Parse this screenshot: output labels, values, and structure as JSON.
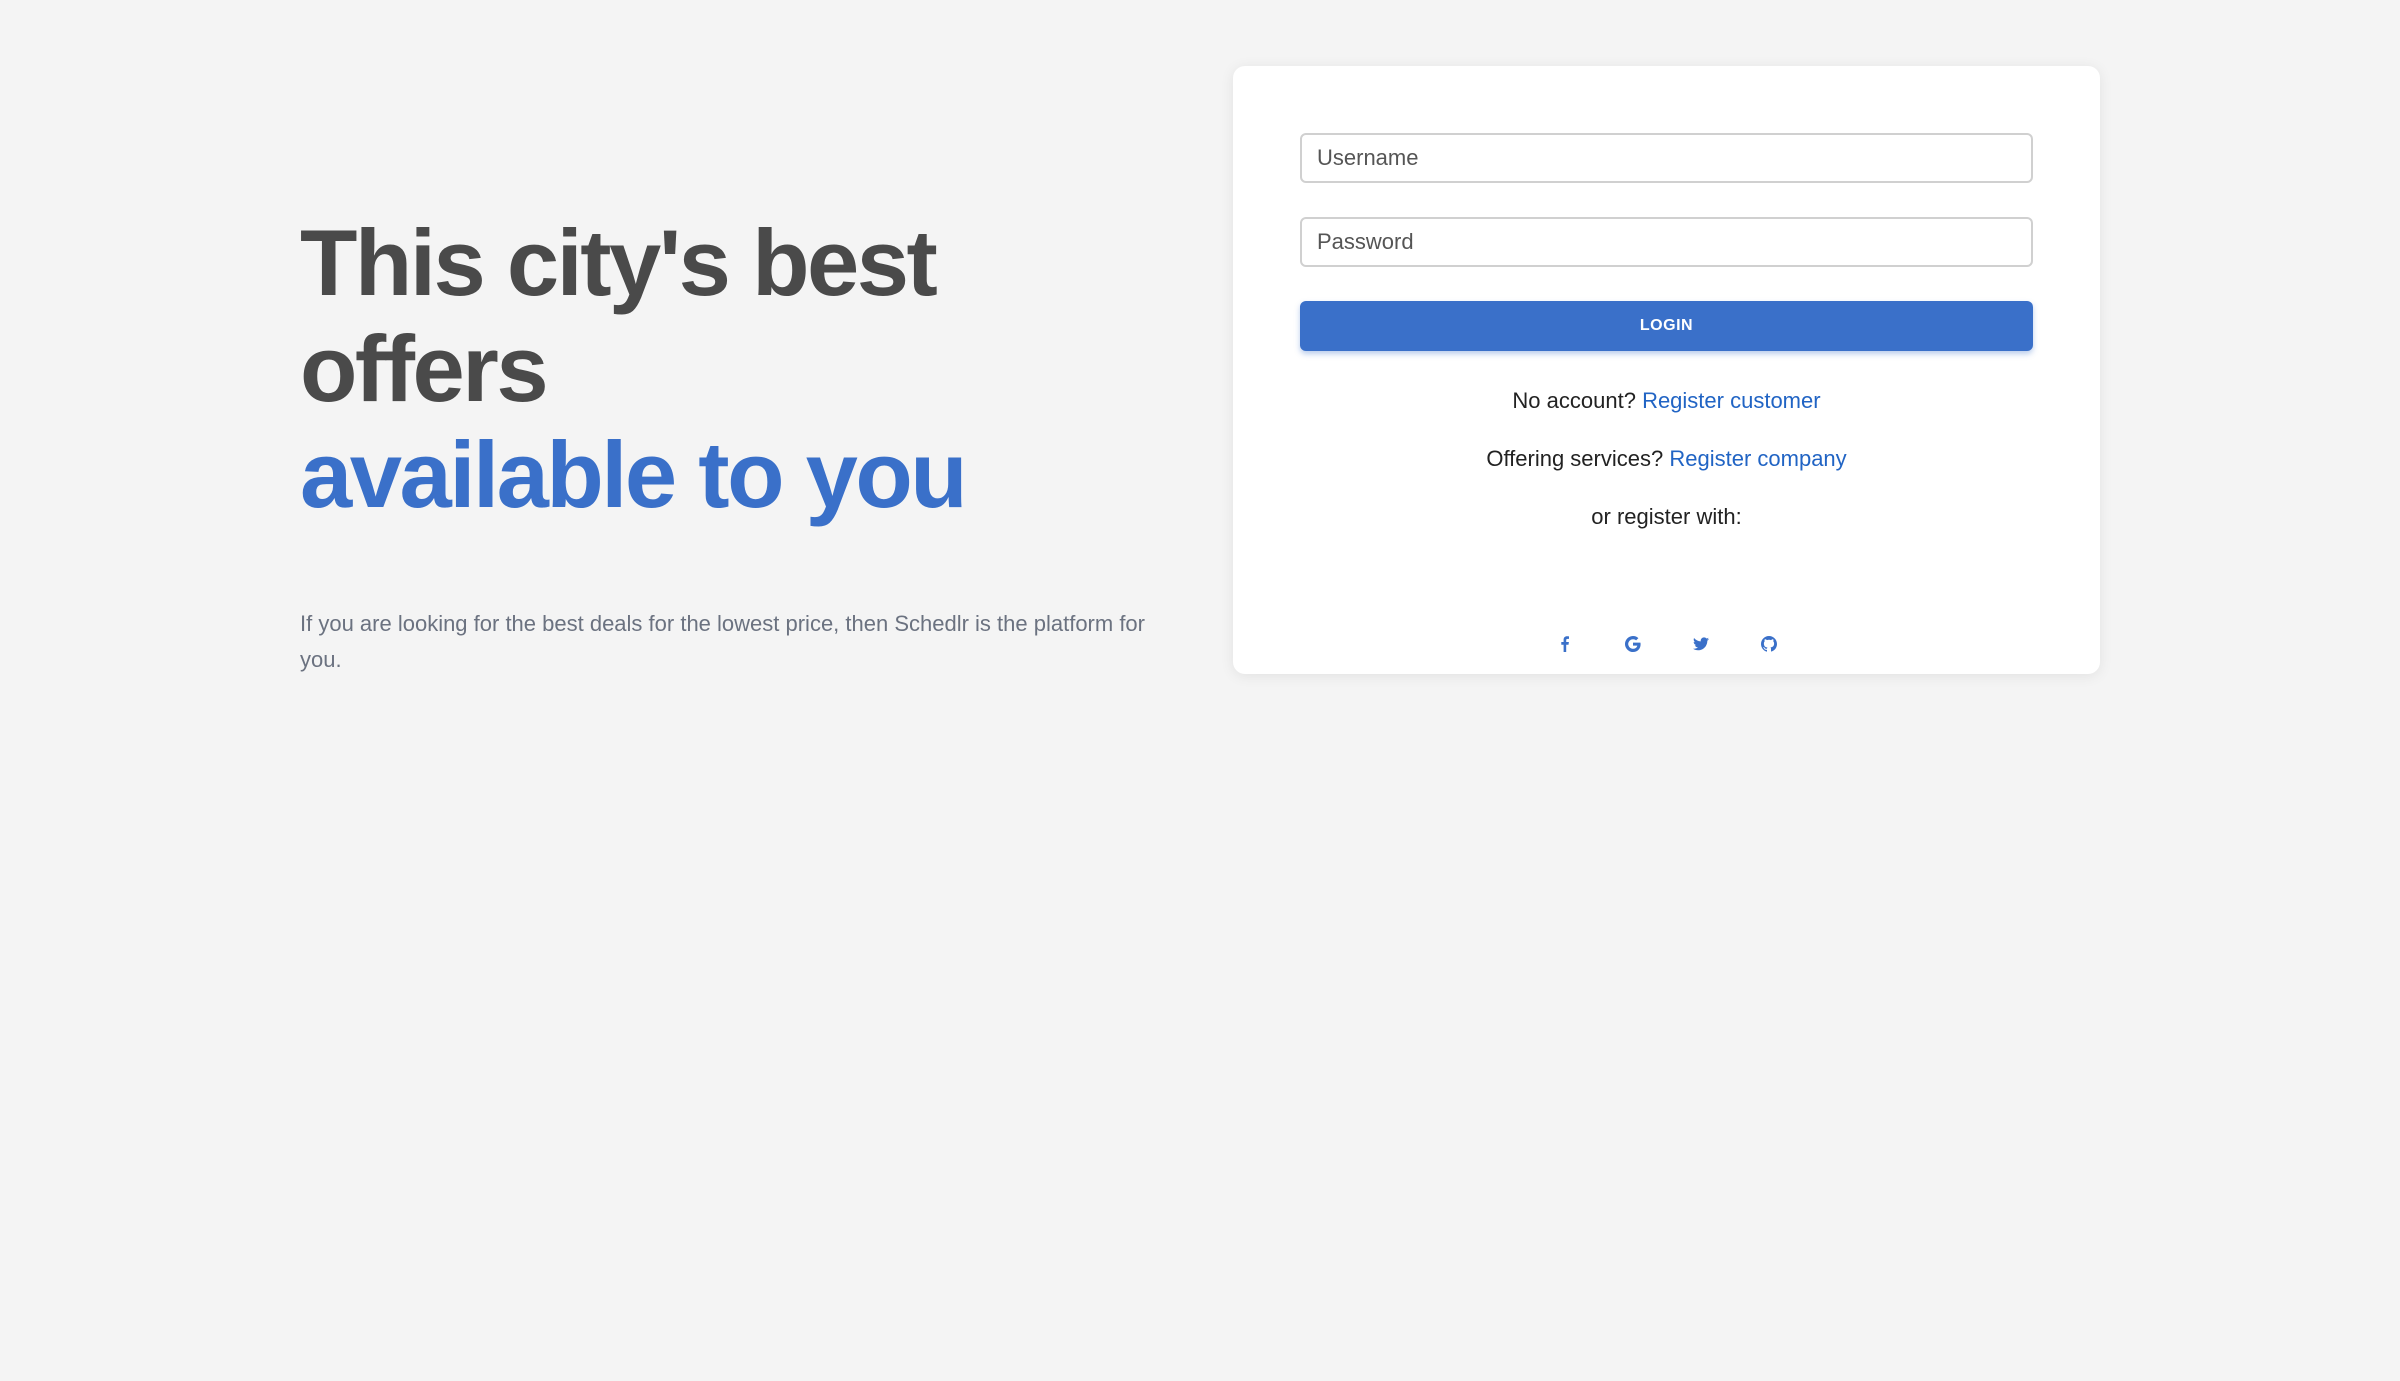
{
  "hero": {
    "title_line1": "This city's best offers",
    "title_line2": "available to you",
    "description": "If you are looking for the best deals for the lowest price, then Schedlr is the platform for you."
  },
  "login": {
    "username_placeholder": "Username",
    "password_placeholder": "Password",
    "login_label": "LOGIN",
    "no_account_text": "No account?",
    "register_customer_link": "Register customer",
    "offering_services_text": "Offering services?",
    "register_company_link": "Register company",
    "or_register_with": "or register with:",
    "socials": [
      {
        "icon": "facebook-icon"
      },
      {
        "icon": "google-icon"
      },
      {
        "icon": "twitter-icon"
      },
      {
        "icon": "github-icon"
      }
    ]
  },
  "colors": {
    "background": "#f4f4f4",
    "accent": "#3a70c9",
    "link": "#2164c4",
    "heading_dark": "#4a4a4a",
    "muted_text": "#6b7280"
  }
}
